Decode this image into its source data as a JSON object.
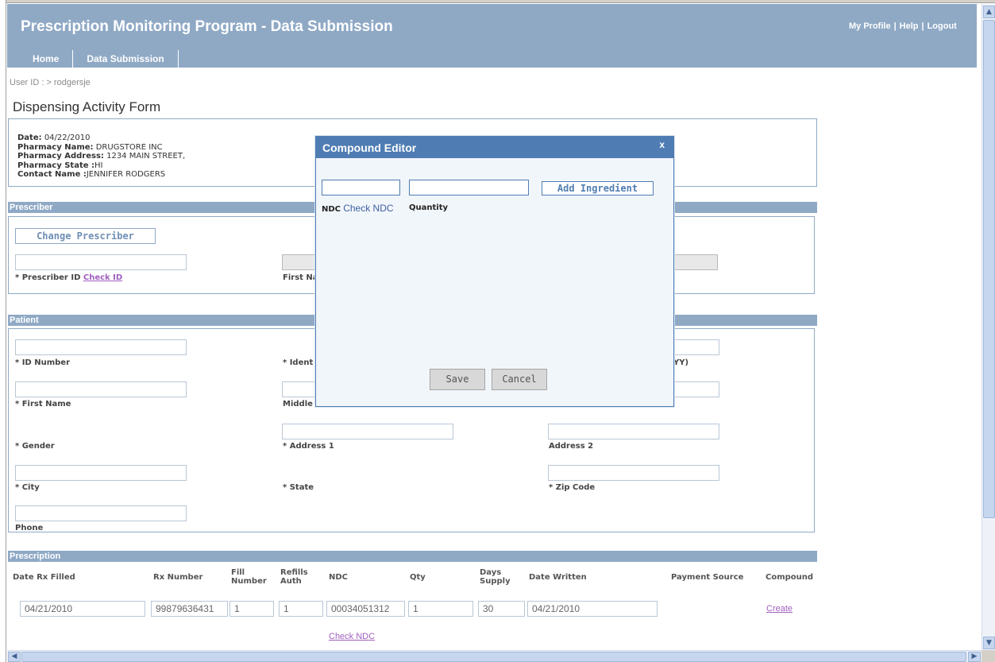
{
  "header": {
    "title": "Prescription Monitoring Program - Data Submission",
    "links": {
      "profile": "My Profile",
      "help": "Help",
      "logout": "Logout",
      "sep": "|"
    },
    "nav": [
      "Home",
      "Data Submission"
    ]
  },
  "user_id": "User ID : > rodgersje",
  "form_title": "Dispensing Activity Form",
  "pharmacy": {
    "date_label": "Date:",
    "date": "04/22/2010",
    "name_label": "Pharmacy Name:",
    "name": "DRUGSTORE INC",
    "address_label": "Pharmacy Address:",
    "address": "1234 MAIN STREET,",
    "state_label": "Pharmacy State :",
    "state": "HI",
    "contact_label": "Contact Name :",
    "contact": "JENNIFER  RODGERS"
  },
  "prescriber": {
    "section": "Prescriber",
    "change_button": "Change Prescriber",
    "id_label": "* Prescriber ID",
    "check_id": "Check ID",
    "first_name_label": "First Na"
  },
  "patient": {
    "section": "Patient",
    "id_number": "* ID Number",
    "ident": "* Ident",
    "dob_fragment": "YY)",
    "first_name": "* First Name",
    "middle": "Middle",
    "gender": "* Gender",
    "address1": "* Address 1",
    "address2": "Address 2",
    "city": "* City",
    "state": "* State",
    "zip": "* Zip Code",
    "phone": "Phone"
  },
  "prescription": {
    "section": "Prescription",
    "columns": {
      "date_filled": "Date Rx Filled",
      "rx_number": "Rx Number",
      "fill_number": "Fill Number",
      "refills_auth": "Refills Auth",
      "ndc": "NDC",
      "qty": "Qty",
      "days_supply": "Days Supply",
      "date_written": "Date Written",
      "payment_source": "Payment Source",
      "compound": "Compound"
    },
    "row": {
      "date_filled": "04/21/2010",
      "rx_number": "99879636431",
      "fill_number": "1",
      "refills_auth": "1",
      "ndc": "00034051312",
      "qty": "1",
      "days_supply": "30",
      "date_written": "04/21/2010",
      "create": "Create"
    },
    "check_ndc": "Check NDC"
  },
  "modal": {
    "title": "Compound Editor",
    "close": "x",
    "ndc_label": "NDC",
    "check_ndc": "Check NDC",
    "quantity_label": "Quantity",
    "add_button": "Add Ingredient",
    "save": "Save",
    "cancel": "Cancel",
    "ndc_value": "",
    "quantity_value": ""
  },
  "scrollbars": {
    "up": "▲",
    "down": "▼",
    "left": "◀",
    "right": "▶"
  },
  "colors": {
    "header": "#8fa9c5",
    "modal_header": "#4f7db3",
    "link": "#a05fbf"
  }
}
